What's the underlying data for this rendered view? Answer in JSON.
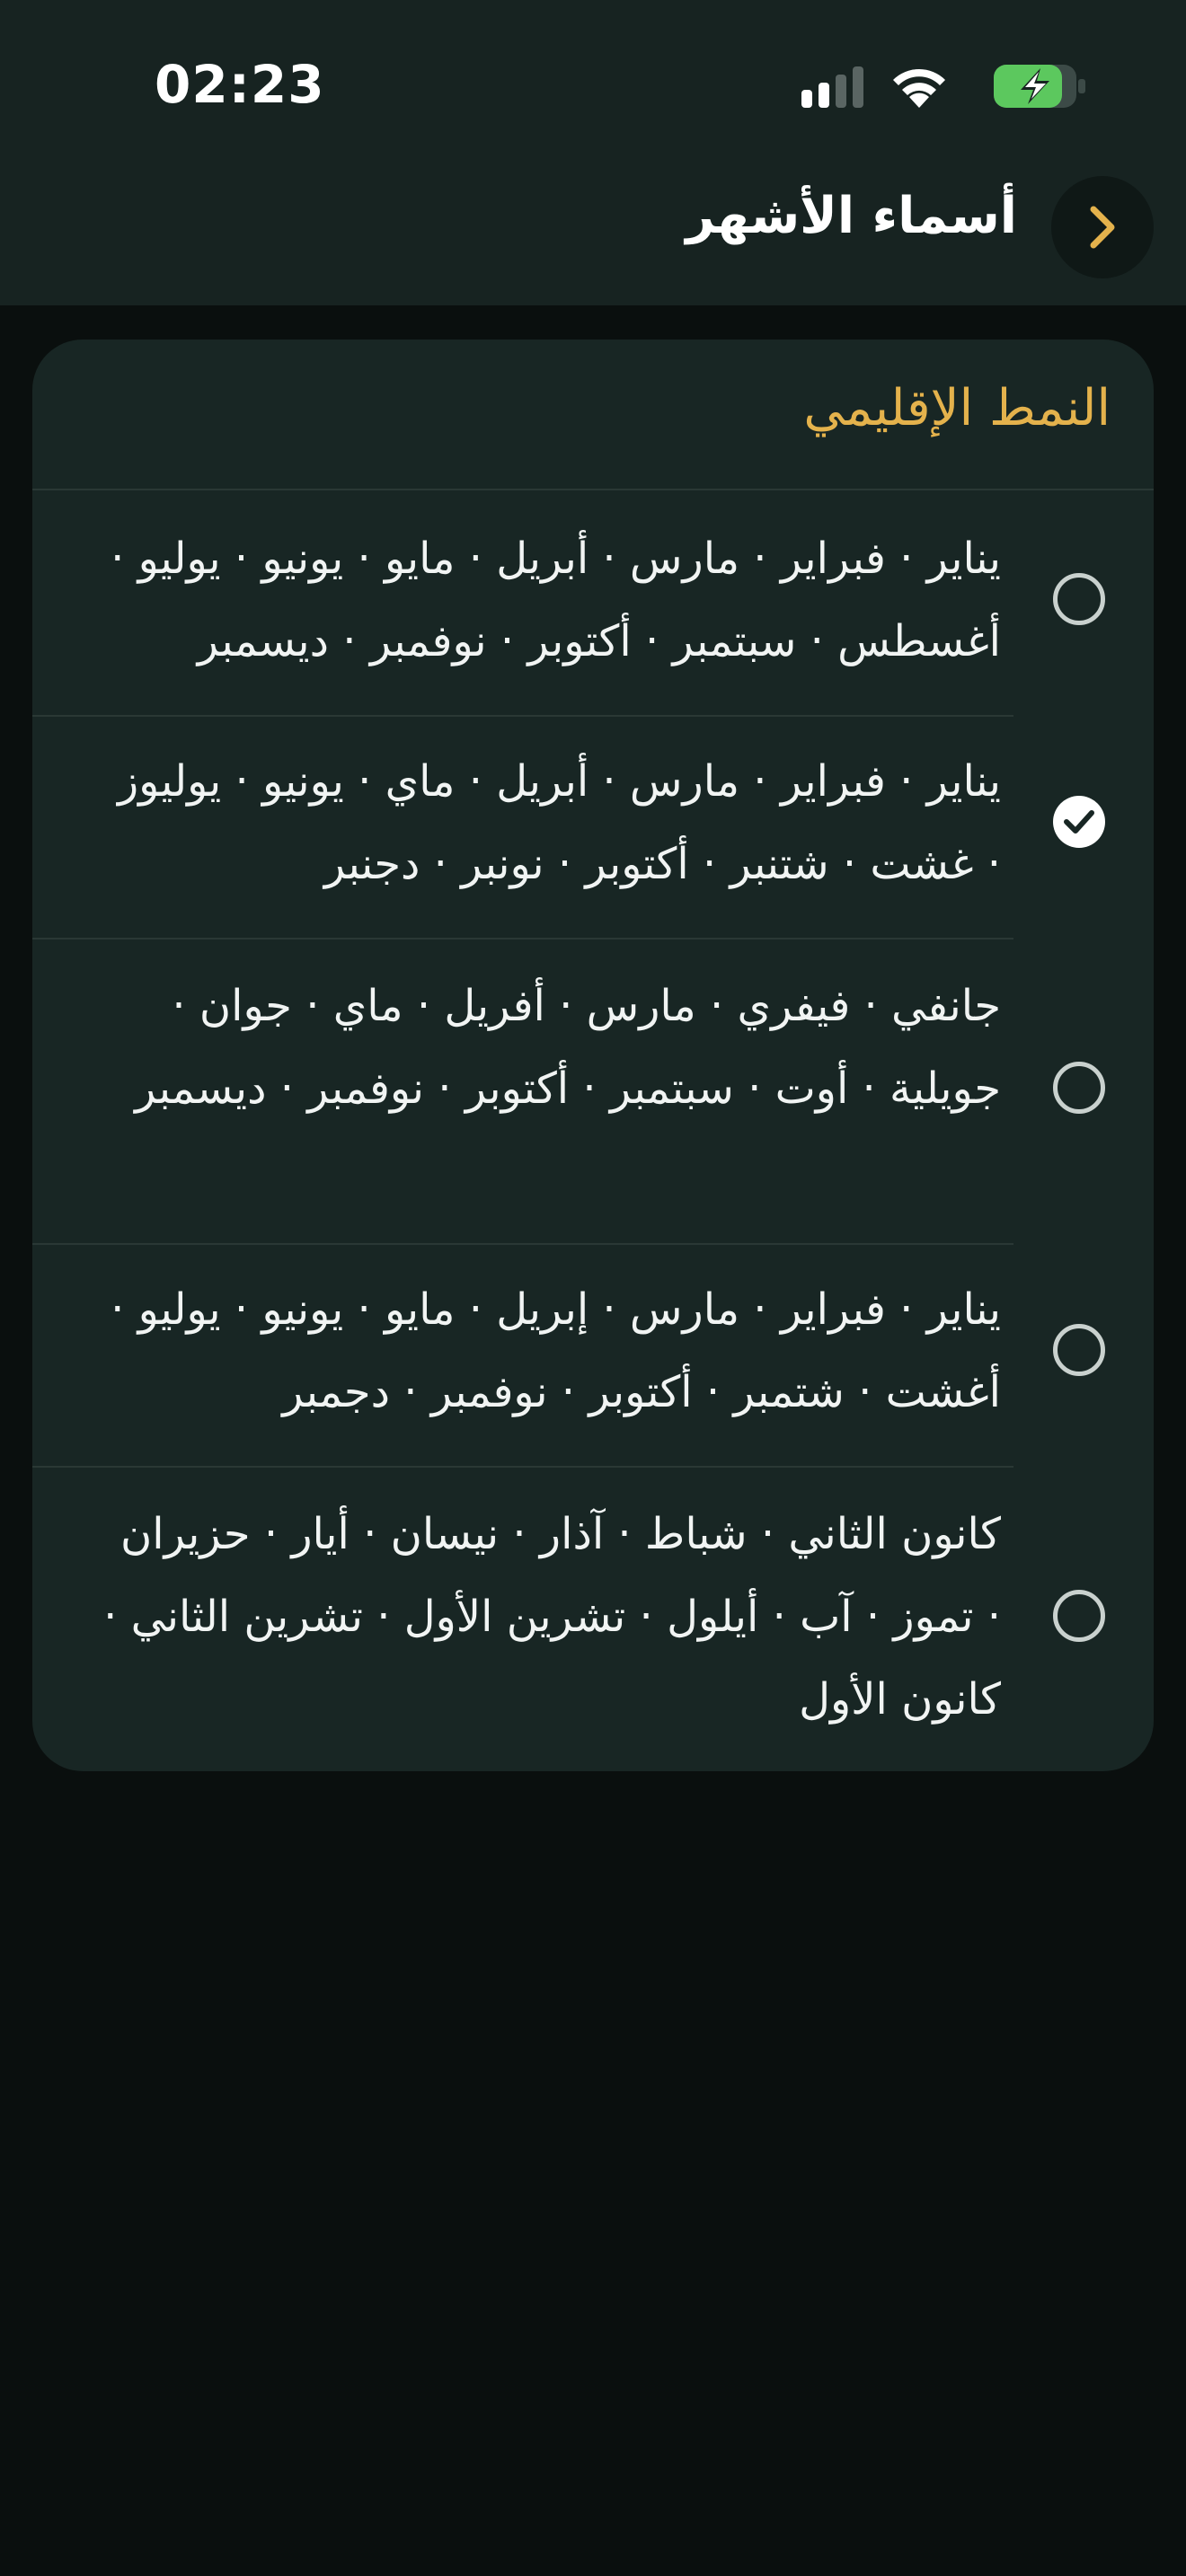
{
  "status_bar": {
    "time": "02:23",
    "icons": [
      "signal-icon",
      "wifi-icon",
      "battery-charging-icon"
    ]
  },
  "nav": {
    "title": "أسماء الأشهر",
    "back_icon": "chevron-right-icon"
  },
  "section": {
    "title": "النمط الإقليمي"
  },
  "options": [
    {
      "text": "يناير · فبراير · مارس · أبريل · مايو · يونيو · يوليو · أغسطس · سبتمبر · أكتوبر · نوفمبر · ديسمبر",
      "selected": false
    },
    {
      "text": "يناير · فبراير · مارس · أبريل · ماي · يونيو · يوليوز · غشت · شتنبر · أكتوبر · نونبر · دجنبر",
      "selected": true
    },
    {
      "text": "جانفي · فيفري · مارس · أفريل · ماي · جوان · جويلية · أوت · سبتمبر · أكتوبر · نوفمبر · ديسمبر",
      "selected": false
    },
    {
      "text": "يناير · فبراير · مارس · إبريل · مايو · يونيو · يوليو · أغشت · شتمبر · أكتوبر · نوفمبر · دجمبر",
      "selected": false
    },
    {
      "text": "كانون الثاني · شباط · آذار · نيسان · أيار · حزيران · تموز · آب · أيلول · تشرين الأول · تشرين الثاني · كانون الأول",
      "selected": false
    }
  ],
  "colors": {
    "accent": "#e4b24c",
    "background": "#0a0f0e",
    "card": "#182624",
    "battery": "#5cc85e"
  }
}
